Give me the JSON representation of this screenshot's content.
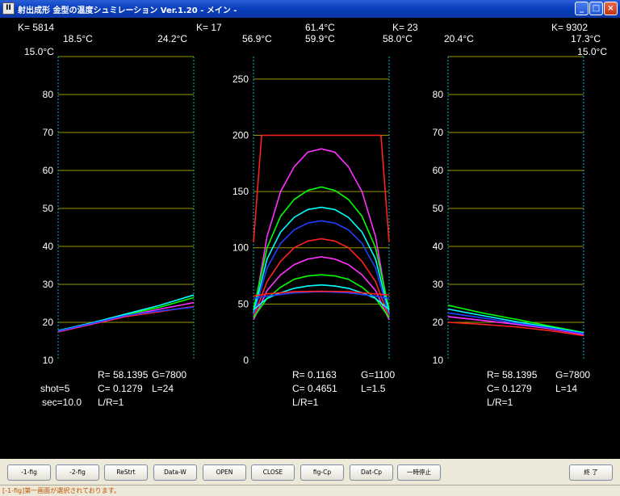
{
  "window": {
    "title": "射出成形 金型の温度シュミレーション Ver.1.20 - メイン -",
    "icon_text": "II",
    "minimize_glyph": "_",
    "maximize_glyph": "□",
    "close_glyph": "×"
  },
  "colors": {
    "grid": "#9a9a00",
    "axis_cyan": "#00bcd4",
    "text": "#ffffff"
  },
  "panels": {
    "left": {
      "k": "K= 5814",
      "temps_row1": [
        "18.5°C",
        "24.2°C"
      ],
      "temps_row2": [
        "15.0°C"
      ],
      "info_row1": [
        "R= 58.1395",
        "G=7800"
      ],
      "info_row2": [
        "C= 0.1279",
        "L=24"
      ],
      "info_row3": [
        "L/R=1"
      ],
      "side_info": [
        "shot=5",
        "sec=10.0"
      ]
    },
    "center": {
      "k": "K= 17",
      "k_right": "K= 23",
      "temps_row1": [
        "61.4°C"
      ],
      "temps_row2": [
        "56.9°C",
        "59.9°C",
        "58.0°C"
      ],
      "info_row1": [
        "R= 0.1163",
        "G=1100"
      ],
      "info_row2": [
        "C= 0.4651",
        "L=1.5"
      ],
      "info_row3": [
        "L/R=1"
      ]
    },
    "right": {
      "k": "K= 9302",
      "temps_row1": [
        "20.4°C",
        "17.3°C"
      ],
      "temps_row2": [
        "15.0°C"
      ],
      "info_row1": [
        "R= 58.1395",
        "G=7800"
      ],
      "info_row2": [
        "C= 0.1279",
        "L=14"
      ],
      "info_row3": [
        "L/R=1"
      ]
    }
  },
  "chart_data": [
    {
      "type": "line",
      "panel": "left",
      "ylim": [
        10,
        90
      ],
      "yticks": [
        10,
        20,
        30,
        40,
        50,
        60,
        70,
        80
      ],
      "xlim": [
        0,
        1
      ],
      "series": [
        {
          "color": "#ff2020",
          "x": [
            0,
            0.25,
            0.5,
            0.75,
            1
          ],
          "y": [
            17.5,
            19.5,
            21.5,
            22.8,
            24.2
          ]
        },
        {
          "color": "#ff30ff",
          "x": [
            0,
            0.25,
            0.5,
            0.75,
            1
          ],
          "y": [
            17.6,
            19.6,
            21.7,
            23.5,
            25.2
          ]
        },
        {
          "color": "#00ff00",
          "x": [
            0,
            0.25,
            0.5,
            0.75,
            1
          ],
          "y": [
            17.8,
            19.8,
            22.0,
            24.0,
            26.5
          ]
        },
        {
          "color": "#00ffff",
          "x": [
            0,
            0.25,
            0.5,
            0.75,
            1
          ],
          "y": [
            17.8,
            19.9,
            22.2,
            24.5,
            27.2
          ]
        },
        {
          "color": "#2040ff",
          "x": [
            0,
            0.25,
            0.5,
            0.75,
            1
          ],
          "y": [
            17.7,
            19.7,
            21.8,
            23.0,
            24.0
          ]
        }
      ]
    },
    {
      "type": "line",
      "panel": "center",
      "ylim": [
        0,
        270
      ],
      "yticks": [
        0,
        50,
        100,
        150,
        200,
        250
      ],
      "xlim": [
        0,
        1
      ],
      "series": [
        {
          "color": "#ff2020",
          "x": [
            0,
            0.06,
            0.94,
            1
          ],
          "y": [
            105,
            200,
            200,
            105
          ]
        },
        {
          "color": "#ff30ff",
          "x": [
            0,
            0.1,
            0.2,
            0.3,
            0.4,
            0.5,
            0.6,
            0.7,
            0.8,
            0.9,
            1
          ],
          "y": [
            40,
            110,
            150,
            172,
            185,
            188,
            185,
            172,
            150,
            110,
            40
          ]
        },
        {
          "color": "#00ff00",
          "x": [
            0,
            0.1,
            0.2,
            0.3,
            0.4,
            0.5,
            0.6,
            0.7,
            0.8,
            0.9,
            1
          ],
          "y": [
            45,
            100,
            128,
            143,
            151,
            154,
            151,
            143,
            128,
            100,
            45
          ]
        },
        {
          "color": "#00ffff",
          "x": [
            0,
            0.1,
            0.2,
            0.3,
            0.4,
            0.5,
            0.6,
            0.7,
            0.8,
            0.9,
            1
          ],
          "y": [
            42,
            90,
            114,
            127,
            134,
            136,
            134,
            127,
            114,
            90,
            42
          ]
        },
        {
          "color": "#2040ff",
          "x": [
            0,
            0.1,
            0.2,
            0.3,
            0.4,
            0.5,
            0.6,
            0.7,
            0.8,
            0.9,
            1
          ],
          "y": [
            40,
            82,
            104,
            116,
            122,
            124,
            122,
            116,
            104,
            82,
            40
          ]
        },
        {
          "color": "#ff2020",
          "x": [
            0,
            0.1,
            0.2,
            0.3,
            0.4,
            0.5,
            0.6,
            0.7,
            0.8,
            0.9,
            1
          ],
          "y": [
            38,
            70,
            88,
            100,
            106,
            108,
            106,
            100,
            88,
            70,
            38
          ]
        },
        {
          "color": "#ff30ff",
          "x": [
            0,
            0.1,
            0.2,
            0.3,
            0.4,
            0.5,
            0.6,
            0.7,
            0.8,
            0.9,
            1
          ],
          "y": [
            36,
            62,
            76,
            85,
            90,
            92,
            90,
            85,
            76,
            62,
            36
          ]
        },
        {
          "color": "#00ff00",
          "x": [
            0,
            0.1,
            0.2,
            0.3,
            0.4,
            0.5,
            0.6,
            0.7,
            0.8,
            0.9,
            1
          ],
          "y": [
            38,
            55,
            65,
            72,
            75,
            76,
            75,
            72,
            65,
            55,
            38
          ]
        },
        {
          "color": "#00ffff",
          "x": [
            0,
            0.1,
            0.2,
            0.3,
            0.4,
            0.5,
            0.6,
            0.7,
            0.8,
            0.9,
            1
          ],
          "y": [
            45,
            55,
            60,
            64,
            66,
            67,
            66,
            64,
            60,
            55,
            45
          ]
        },
        {
          "color": "#2040ff",
          "x": [
            0,
            0.1,
            0.3,
            0.5,
            0.7,
            0.9,
            1
          ],
          "y": [
            55,
            57,
            60,
            61,
            60,
            57,
            55
          ]
        },
        {
          "color": "#ff2020",
          "x": [
            0,
            0.1,
            0.3,
            0.5,
            0.7,
            0.9,
            1
          ],
          "y": [
            57,
            59,
            61,
            61.4,
            61,
            59,
            58
          ]
        }
      ]
    },
    {
      "type": "line",
      "panel": "right",
      "ylim": [
        10,
        90
      ],
      "yticks": [
        10,
        20,
        30,
        40,
        50,
        60,
        70,
        80
      ],
      "xlim": [
        0,
        1
      ],
      "series": [
        {
          "color": "#ff2020",
          "x": [
            0,
            0.25,
            0.5,
            0.75,
            1
          ],
          "y": [
            20.0,
            19.5,
            18.8,
            17.8,
            16.5
          ]
        },
        {
          "color": "#ff30ff",
          "x": [
            0,
            0.25,
            0.5,
            0.75,
            1
          ],
          "y": [
            21.5,
            20.5,
            19.5,
            18.3,
            16.8
          ]
        },
        {
          "color": "#00ff00",
          "x": [
            0,
            0.25,
            0.5,
            0.75,
            1
          ],
          "y": [
            24.5,
            22.5,
            20.8,
            19.0,
            17.3
          ]
        },
        {
          "color": "#00ffff",
          "x": [
            0,
            0.25,
            0.5,
            0.75,
            1
          ],
          "y": [
            23.5,
            21.8,
            20.2,
            18.7,
            17.2
          ]
        },
        {
          "color": "#2040ff",
          "x": [
            0,
            0.25,
            0.5,
            0.75,
            1
          ],
          "y": [
            22.5,
            21.2,
            19.8,
            18.5,
            17.0
          ]
        }
      ]
    }
  ],
  "buttons": [
    "-1-fig",
    "-2-fig",
    "ReStrt",
    "Data-W",
    "OPEN",
    "CLOSE",
    "fig-Cp",
    "Dat-Cp",
    "一時停止"
  ],
  "exit_button": "終 了",
  "status_text": "[-1-fig]第一画面が選択されております。"
}
